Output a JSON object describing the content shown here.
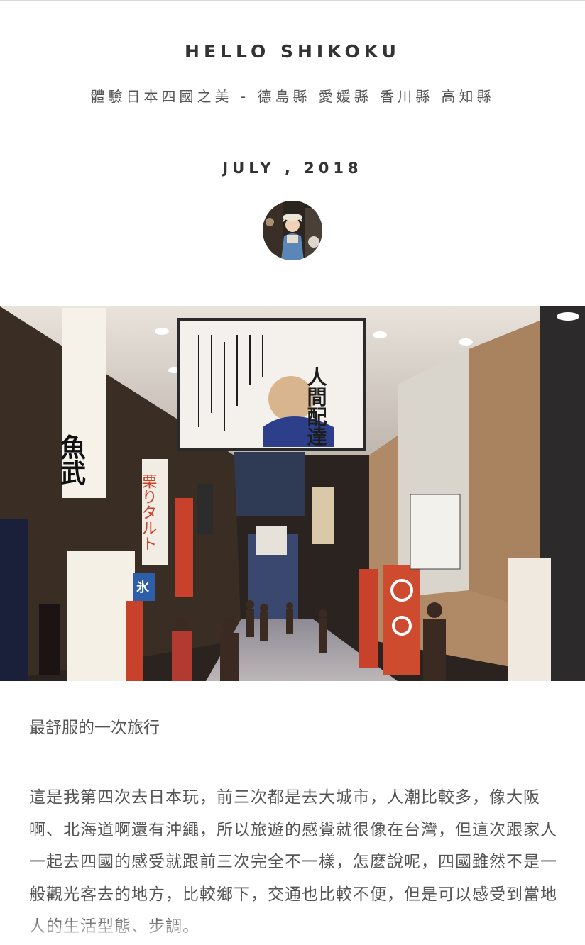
{
  "header": {
    "site_title": "HELLO SHIKOKU",
    "subtitle": "體驗日本四國之美 - 德島縣 愛媛縣 香川縣 高知縣"
  },
  "post": {
    "date": "JULY , 2018",
    "avatar_alt": "author avatar",
    "hero_alt": "shopping arcade photo",
    "lead": "最舒服的一次旅行",
    "paragraph": "這是我第四次去日本玩，前三次都是去大城市，人潮比較多，像大阪啊、北海道啊還有沖繩，所以旅遊的感覺就很像在台灣，但這次跟家人一起去四國的感受就跟前三次完全不一樣，怎麼說呢，四國雖然不是一般觀光客去的地方，比較鄉下，交通也比較不便，但是可以感受到當地人的生活型態、步調。"
  },
  "photo_signs": {
    "banner_text": "人間配達",
    "left_sign": "魚武",
    "left_banner": "栗りタルト",
    "ice_flag": "氷"
  },
  "colors": {
    "title": "#333333",
    "body_text": "#555555",
    "accent_red": "#c8412a"
  }
}
